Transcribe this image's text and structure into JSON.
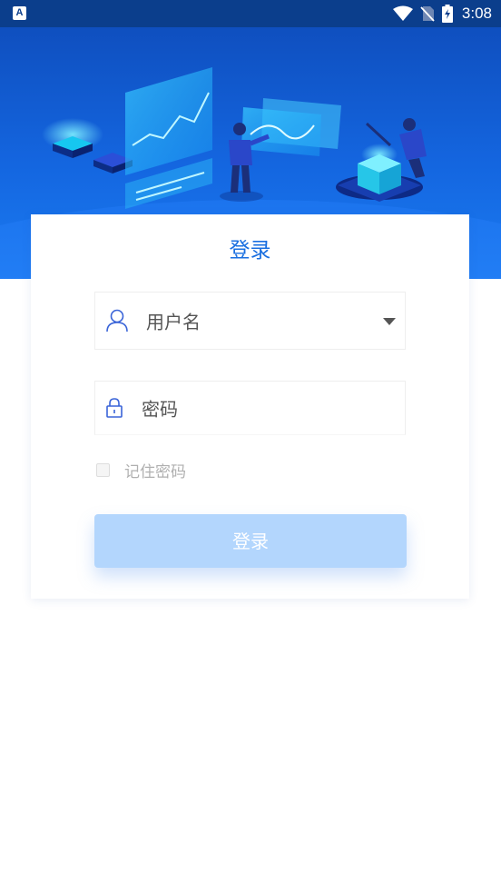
{
  "status_bar": {
    "app_badge": "A",
    "time": "3:08"
  },
  "hero": {
    "illustration": "data-analytics-team-illustration"
  },
  "login": {
    "title": "登录",
    "username_placeholder": "用户名",
    "password_placeholder": "密码",
    "remember_label": "记住密码",
    "remember_checked": false,
    "submit_label": "登录"
  },
  "colors": {
    "brand": "#1a6fe0",
    "hero_top": "#0f4fbf",
    "button_disabled": "#b3d6fd",
    "status_bar": "#0b3e8c"
  }
}
